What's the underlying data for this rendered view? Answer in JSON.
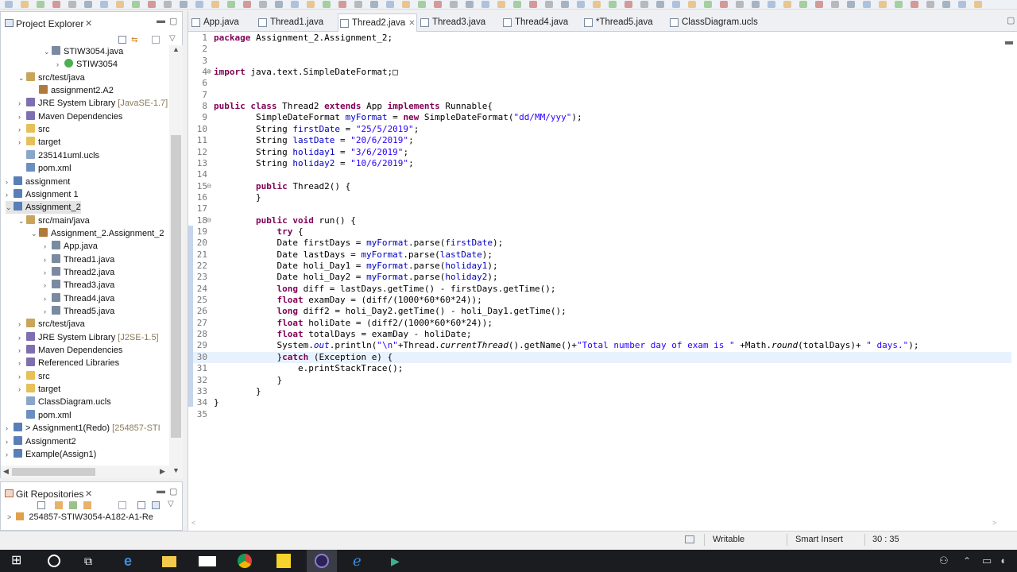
{
  "project_explorer": {
    "title": "Project Explorer",
    "tree": [
      {
        "label": "STIW3054.java",
        "indent": 3,
        "twisty": "v",
        "icon": "java-file-icon"
      },
      {
        "label": "STIW3054",
        "indent": 4,
        "twisty": ">",
        "icon": "class-icon"
      },
      {
        "label": "src/test/java",
        "indent": 1,
        "twisty": "v",
        "icon": "package-folder-icon"
      },
      {
        "label": "assignment2.A2",
        "indent": 2,
        "twisty": "",
        "icon": "package-icon"
      },
      {
        "label": "JRE System Library",
        "decor": "[JavaSE-1.7]",
        "indent": 1,
        "twisty": ">",
        "icon": "library-icon"
      },
      {
        "label": "Maven Dependencies",
        "indent": 1,
        "twisty": ">",
        "icon": "library-icon"
      },
      {
        "label": "src",
        "indent": 1,
        "twisty": ">",
        "icon": "folder-icon"
      },
      {
        "label": "target",
        "indent": 1,
        "twisty": ">",
        "icon": "folder-icon"
      },
      {
        "label": "235141uml.ucls",
        "indent": 1,
        "twisty": "",
        "icon": "file-icon"
      },
      {
        "label": "pom.xml",
        "indent": 1,
        "twisty": "",
        "icon": "xml-file-icon"
      },
      {
        "label": "assignment",
        "indent": 0,
        "twisty": ">",
        "icon": "project-icon"
      },
      {
        "label": "Assignment 1",
        "indent": 0,
        "twisty": ">",
        "icon": "project-icon"
      },
      {
        "label": "Assignment_2",
        "indent": 0,
        "twisty": "v",
        "icon": "project-icon",
        "selected": true
      },
      {
        "label": "src/main/java",
        "indent": 1,
        "twisty": "v",
        "icon": "package-folder-icon"
      },
      {
        "label": "Assignment_2.Assignment_2",
        "indent": 2,
        "twisty": "v",
        "icon": "package-icon"
      },
      {
        "label": "App.java",
        "indent": 3,
        "twisty": ">",
        "icon": "java-file-icon"
      },
      {
        "label": "Thread1.java",
        "indent": 3,
        "twisty": ">",
        "icon": "java-file-icon"
      },
      {
        "label": "Thread2.java",
        "indent": 3,
        "twisty": ">",
        "icon": "java-file-icon"
      },
      {
        "label": "Thread3.java",
        "indent": 3,
        "twisty": ">",
        "icon": "java-file-icon"
      },
      {
        "label": "Thread4.java",
        "indent": 3,
        "twisty": ">",
        "icon": "java-file-icon"
      },
      {
        "label": "Thread5.java",
        "indent": 3,
        "twisty": ">",
        "icon": "java-file-icon"
      },
      {
        "label": "src/test/java",
        "indent": 1,
        "twisty": ">",
        "icon": "package-folder-icon"
      },
      {
        "label": "JRE System Library",
        "decor": "[J2SE-1.5]",
        "indent": 1,
        "twisty": ">",
        "icon": "library-icon"
      },
      {
        "label": "Maven Dependencies",
        "indent": 1,
        "twisty": ">",
        "icon": "library-icon"
      },
      {
        "label": "Referenced Libraries",
        "indent": 1,
        "twisty": ">",
        "icon": "library-icon"
      },
      {
        "label": "src",
        "indent": 1,
        "twisty": ">",
        "icon": "folder-icon"
      },
      {
        "label": "target",
        "indent": 1,
        "twisty": ">",
        "icon": "folder-icon"
      },
      {
        "label": "ClassDiagram.ucls",
        "indent": 1,
        "twisty": "",
        "icon": "file-icon"
      },
      {
        "label": "pom.xml",
        "indent": 1,
        "twisty": "",
        "icon": "xml-file-icon"
      },
      {
        "label": "> Assignment1(Redo)",
        "decor": "[254857-STI",
        "indent": 0,
        "twisty": ">",
        "icon": "project-icon"
      },
      {
        "label": "Assignment2",
        "indent": 0,
        "twisty": ">",
        "icon": "project-icon"
      },
      {
        "label": "Example(Assign1)",
        "indent": 0,
        "twisty": ">",
        "icon": "project-icon"
      }
    ]
  },
  "git_repositories": {
    "title": "Git Repositories",
    "item": "254857-STIW3054-A182-A1-Re"
  },
  "editor": {
    "tabs": [
      {
        "label": "App.java",
        "active": false
      },
      {
        "label": "Thread1.java",
        "active": false
      },
      {
        "label": "Thread2.java",
        "active": true
      },
      {
        "label": "Thread3.java",
        "active": false
      },
      {
        "label": "Thread4.java",
        "active": false
      },
      {
        "label": "*Thread5.java",
        "active": false
      },
      {
        "label": "ClassDiagram.ucls",
        "active": false
      }
    ],
    "current_line": 30,
    "code": [
      {
        "n": "1",
        "html": "<span class=\"kw\">package</span> Assignment_2.Assignment_2;"
      },
      {
        "n": "2",
        "html": ""
      },
      {
        "n": "3",
        "html": ""
      },
      {
        "n": "4",
        "fold": "+",
        "html": "<span class=\"kw\">import</span> java.text.SimpleDateFormat;&#9633;"
      },
      {
        "n": "6",
        "html": ""
      },
      {
        "n": "7",
        "html": ""
      },
      {
        "n": "8",
        "html": "<span class=\"kw\">public class</span> Thread2 <span class=\"kw\">extends</span> App <span class=\"kw\">implements</span> Runnable{"
      },
      {
        "n": "9",
        "html": "        SimpleDateFormat <span class=\"fld\">myFormat</span> = <span class=\"kw\">new</span> SimpleDateFormat(<span class=\"str\">\"dd/MM/yyy\"</span>);"
      },
      {
        "n": "10",
        "html": "        String <span class=\"fld\">firstDate</span> = <span class=\"str\">\"25/5/2019\"</span>;"
      },
      {
        "n": "11",
        "html": "        String <span class=\"fld\">lastDate</span> = <span class=\"str\">\"20/6/2019\"</span>;"
      },
      {
        "n": "12",
        "html": "        String <span class=\"fld\">holiday1</span> = <span class=\"str\">\"3/6/2019\"</span>;"
      },
      {
        "n": "13",
        "html": "        String <span class=\"fld\">holiday2</span> = <span class=\"str\">\"10/6/2019\"</span>;"
      },
      {
        "n": "14",
        "html": ""
      },
      {
        "n": "15",
        "fold": "-",
        "html": "        <span class=\"kw\">public</span> Thread2() {"
      },
      {
        "n": "16",
        "html": "        }"
      },
      {
        "n": "17",
        "html": ""
      },
      {
        "n": "18",
        "fold": "-",
        "html": "        <span class=\"kw\">public void</span> run() {"
      },
      {
        "n": "19",
        "html": "            <span class=\"kw\">try</span> {"
      },
      {
        "n": "20",
        "html": "            Date firstDays = <span class=\"fld\">myFormat</span>.parse(<span class=\"fld\">firstDate</span>);"
      },
      {
        "n": "21",
        "html": "            Date lastDays = <span class=\"fld\">myFormat</span>.parse(<span class=\"fld\">lastDate</span>);"
      },
      {
        "n": "22",
        "html": "            Date holi_Day1 = <span class=\"fld\">myFormat</span>.parse(<span class=\"fld\">holiday1</span>);"
      },
      {
        "n": "23",
        "html": "            Date holi_Day2 = <span class=\"fld\">myFormat</span>.parse(<span class=\"fld\">holiday2</span>);"
      },
      {
        "n": "24",
        "html": "            <span class=\"kw\">long</span> diff = lastDays.getTime() - firstDays.getTime();"
      },
      {
        "n": "25",
        "html": "            <span class=\"kw\">float</span> examDay = (diff/(1000*60*60*24));"
      },
      {
        "n": "26",
        "html": "            <span class=\"kw\">long</span> diff2 = holi_Day2.getTime() - holi_Day1.getTime();"
      },
      {
        "n": "27",
        "html": "            <span class=\"kw\">float</span> holiDate = (diff2/(1000*60*60*24));"
      },
      {
        "n": "28",
        "html": "            <span class=\"kw\">float</span> totalDays = examDay - holiDate;"
      },
      {
        "n": "29",
        "html": "            System.<span class=\"fld stat\">out</span>.println(<span class=\"str\">\"\\n\"</span>+Thread.<span class=\"stat\">currentThread</span>().getName()+<span class=\"str\">\"Total number day of exam is \"</span> +Math.<span class=\"stat\">round</span>(totalDays)+ <span class=\"str\">\" days.\"</span>);"
      },
      {
        "n": "30",
        "html": "            }<span class=\"kw\">catch</span> (Exception e) {"
      },
      {
        "n": "31",
        "html": "                e.printStackTrace();"
      },
      {
        "n": "32",
        "html": "            }"
      },
      {
        "n": "33",
        "html": "        }"
      },
      {
        "n": "34",
        "html": "}"
      },
      {
        "n": "35",
        "html": ""
      }
    ]
  },
  "status_bar": {
    "writable": "Writable",
    "insert_mode": "Smart Insert",
    "position": "30 : 35"
  },
  "taskbar": {
    "apps": [
      "windows-start-icon",
      "search-icon",
      "task-view-icon",
      "edge-icon",
      "file-explorer-icon",
      "mail-icon",
      "chrome-icon",
      "sticky-notes-icon",
      "eclipse-icon",
      "ie-icon",
      "vscode-icon"
    ]
  }
}
